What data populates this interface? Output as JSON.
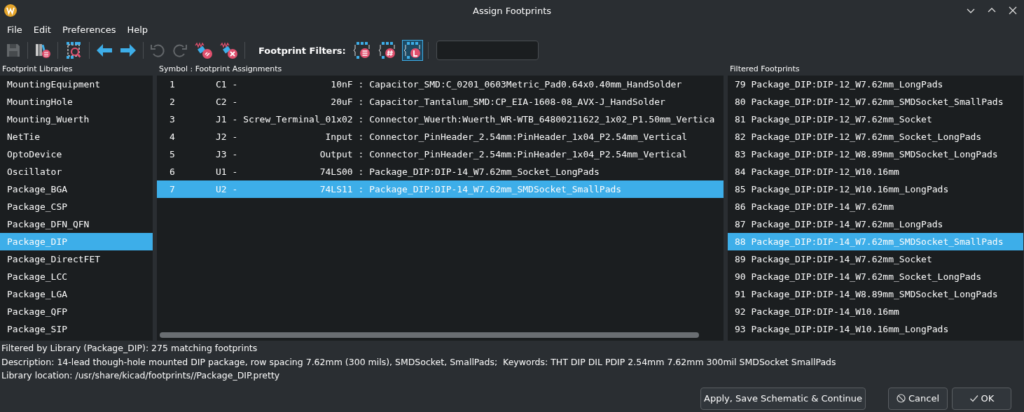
{
  "window": {
    "title": "Assign Footprints"
  },
  "menu": [
    "File",
    "Edit",
    "Preferences",
    "Help"
  ],
  "toolbar": {
    "buttons": [
      {
        "kind": "save",
        "disabled": true
      },
      {
        "kind": "sep"
      },
      {
        "kind": "library-table",
        "disabled": false
      },
      {
        "kind": "sep"
      },
      {
        "kind": "viewer",
        "disabled": false
      },
      {
        "kind": "sep"
      },
      {
        "kind": "previous",
        "disabled": false
      },
      {
        "kind": "next",
        "disabled": false
      },
      {
        "kind": "sep"
      },
      {
        "kind": "undo",
        "disabled": true
      },
      {
        "kind": "redo",
        "disabled": true
      },
      {
        "kind": "auto-associate",
        "disabled": false
      },
      {
        "kind": "delete-associations",
        "disabled": false
      },
      {
        "kind": "sep"
      }
    ],
    "filters_label": "Footprint Filters:",
    "filters": [
      {
        "kind": "keywords",
        "selected": false
      },
      {
        "kind": "pin-count",
        "selected": false
      },
      {
        "kind": "library",
        "selected": true
      }
    ]
  },
  "libraries": {
    "title": "Footprint Libraries",
    "items": [
      {
        "label": "MountingEquipment",
        "selected": false
      },
      {
        "label": "MountingHole",
        "selected": false
      },
      {
        "label": "Mounting_Wuerth",
        "selected": false
      },
      {
        "label": "NetTie",
        "selected": false
      },
      {
        "label": "OptoDevice",
        "selected": false
      },
      {
        "label": "Oscillator",
        "selected": false
      },
      {
        "label": "Package_BGA",
        "selected": false
      },
      {
        "label": "Package_CSP",
        "selected": false
      },
      {
        "label": "Package_DFN_QFN",
        "selected": false
      },
      {
        "label": "Package_DIP",
        "selected": true
      },
      {
        "label": "Package_DirectFET",
        "selected": false
      },
      {
        "label": "Package_LCC",
        "selected": false
      },
      {
        "label": "Package_LGA",
        "selected": false
      },
      {
        "label": "Package_QFP",
        "selected": false
      },
      {
        "label": "Package_SIP",
        "selected": false
      }
    ]
  },
  "assignments": {
    "title": "Symbol : Footprint Assignments",
    "rows": [
      {
        "number": "1",
        "text": "C1 -                 10nF : Capacitor_SMD:C_0201_0603Metric_Pad0.64x0.40mm_HandSolder",
        "selected": false
      },
      {
        "number": "2",
        "text": "C2 -                 20uF : Capacitor_Tantalum_SMD:CP_EIA-1608-08_AVX-J_HandSolder",
        "selected": false
      },
      {
        "number": "3",
        "text": "J1 - Screw_Terminal_01x02 : Connector_Wuerth:Wuerth_WR-WTB_64800211622_1x02_P1.50mm_Vertica",
        "selected": false
      },
      {
        "number": "4",
        "text": "J2 -                Input : Connector_PinHeader_2.54mm:PinHeader_1x04_P2.54mm_Vertical",
        "selected": false
      },
      {
        "number": "5",
        "text": "J3 -               Output : Connector_PinHeader_2.54mm:PinHeader_1x04_P2.54mm_Vertical",
        "selected": false
      },
      {
        "number": "6",
        "text": "U1 -               74LS00 : Package_DIP:DIP-14_W7.62mm_Socket_LongPads",
        "selected": false
      },
      {
        "number": "7",
        "text": "U2 -               74LS11 : Package_DIP:DIP-14_W7.62mm_SMDSocket_SmallPads",
        "selected": true
      }
    ]
  },
  "filtered": {
    "title": "Filtered Footprints",
    "items": [
      {
        "label": "79 Package_DIP:DIP-12_W7.62mm_LongPads",
        "selected": false
      },
      {
        "label": "80 Package_DIP:DIP-12_W7.62mm_SMDSocket_SmallPads",
        "selected": false
      },
      {
        "label": "81 Package_DIP:DIP-12_W7.62mm_Socket",
        "selected": false
      },
      {
        "label": "82 Package_DIP:DIP-12_W7.62mm_Socket_LongPads",
        "selected": false
      },
      {
        "label": "83 Package_DIP:DIP-12_W8.89mm_SMDSocket_LongPads",
        "selected": false
      },
      {
        "label": "84 Package_DIP:DIP-12_W10.16mm",
        "selected": false
      },
      {
        "label": "85 Package_DIP:DIP-12_W10.16mm_LongPads",
        "selected": false
      },
      {
        "label": "86 Package_DIP:DIP-14_W7.62mm",
        "selected": false
      },
      {
        "label": "87 Package_DIP:DIP-14_W7.62mm_LongPads",
        "selected": false
      },
      {
        "label": "88 Package_DIP:DIP-14_W7.62mm_SMDSocket_SmallPads",
        "selected": true
      },
      {
        "label": "89 Package_DIP:DIP-14_W7.62mm_Socket",
        "selected": false
      },
      {
        "label": "90 Package_DIP:DIP-14_W7.62mm_Socket_LongPads",
        "selected": false
      },
      {
        "label": "91 Package_DIP:DIP-14_W8.89mm_SMDSocket_LongPads",
        "selected": false
      },
      {
        "label": "92 Package_DIP:DIP-14_W10.16mm",
        "selected": false
      },
      {
        "label": "93 Package_DIP:DIP-14_W10.16mm_LongPads",
        "selected": false
      }
    ]
  },
  "status": [
    "Filtered by Library (Package_DIP): 275 matching footprints",
    "Description: 14-lead though-hole mounted DIP package, row spacing 7.62mm (300 mils), SMDSocket, SmallPads;  Keywords: THT DIP DIL PDIP 2.54mm 7.62mm 300mil SMDSocket SmallPads",
    "Library location: /usr/share/kicad/footprints//Package_DIP.pretty"
  ],
  "buttons": [
    {
      "kind": "apply",
      "label": "Apply, Save Schematic & Continue"
    },
    {
      "kind": "cancel",
      "label": "Cancel"
    },
    {
      "kind": "ok",
      "label": "OK"
    }
  ]
}
